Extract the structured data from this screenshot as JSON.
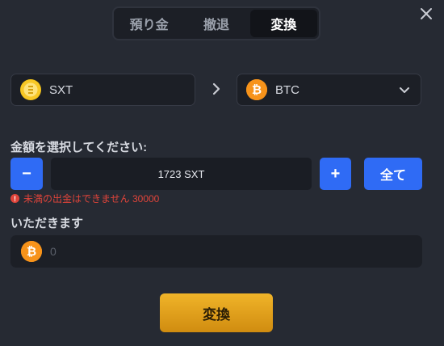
{
  "tabs": [
    {
      "label": "預り金"
    },
    {
      "label": "撤退"
    },
    {
      "label": "変換"
    }
  ],
  "from": {
    "currency": "SXT",
    "icon": "sxt-coin-icon"
  },
  "to": {
    "currency": "BTC",
    "icon": "bitcoin-icon"
  },
  "amount_section": {
    "label": "金額を選択してください:",
    "minus_label": "−",
    "plus_label": "+",
    "all_label": "全て",
    "value": "1723 SXT",
    "error": "未満の出金はできません 30000"
  },
  "receive_section": {
    "label": "いただきます",
    "value": "0"
  },
  "convert_button": "変換",
  "colors": {
    "background": "#262a33",
    "accent_blue": "#2f6bf5",
    "convert_gold": "#f0b429",
    "error_red": "#e0443a",
    "bitcoin_orange": "#f7931a"
  }
}
